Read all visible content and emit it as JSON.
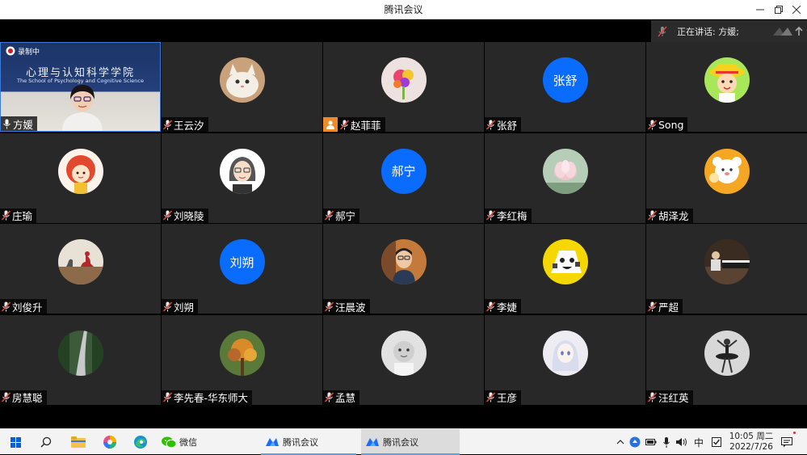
{
  "window": {
    "title": "腾讯会议",
    "speaking_prefix": "正在讲话: 方媛;"
  },
  "presenter": {
    "banner_cn": "心理与认知科学学院",
    "banner_en": "The School of Psychology and Cognitive Science",
    "recording_label": "录制中"
  },
  "participants": [
    {
      "name": "方媛",
      "avatar": "camera",
      "mic": "on"
    },
    {
      "name": "王云汐",
      "avatar": "cat-photo",
      "mic": "muted"
    },
    {
      "name": "赵菲菲",
      "avatar": "flowers-photo",
      "mic": "muted",
      "badge": "person-icon"
    },
    {
      "name": "张舒",
      "avatar": "text",
      "avatar_text": "张舒",
      "mic": "muted"
    },
    {
      "name": "Song",
      "avatar": "cartoon-boy",
      "mic": "muted"
    },
    {
      "name": "庄瑜",
      "avatar": "cartoon-girl",
      "mic": "muted"
    },
    {
      "name": "刘晓陵",
      "avatar": "cartoon-woman",
      "mic": "muted"
    },
    {
      "name": "郝宁",
      "avatar": "text",
      "avatar_text": "郝宁",
      "mic": "muted"
    },
    {
      "name": "李红梅",
      "avatar": "lotus-photo",
      "mic": "muted"
    },
    {
      "name": "胡泽龙",
      "avatar": "cartoon-bear",
      "mic": "muted"
    },
    {
      "name": "刘俊升",
      "avatar": "swan-photo",
      "mic": "muted"
    },
    {
      "name": "刘朔",
      "avatar": "text",
      "avatar_text": "刘朔",
      "mic": "muted"
    },
    {
      "name": "汪晨波",
      "avatar": "man-photo",
      "mic": "muted"
    },
    {
      "name": "李婕",
      "avatar": "cartoon-yellow",
      "mic": "muted"
    },
    {
      "name": "严超",
      "avatar": "piano-photo",
      "mic": "muted"
    },
    {
      "name": "房慧聪",
      "avatar": "road-photo",
      "mic": "muted"
    },
    {
      "name": "李先春-华东师大",
      "avatar": "tree-photo",
      "mic": "muted"
    },
    {
      "name": "孟慧",
      "avatar": "baby-photo",
      "mic": "muted"
    },
    {
      "name": "王彦",
      "avatar": "anime-photo",
      "mic": "muted"
    },
    {
      "name": "汪红英",
      "avatar": "dancer-photo",
      "mic": "muted"
    }
  ],
  "taskbar": {
    "apps": [
      {
        "label": "微信",
        "icon": "wechat-icon"
      },
      {
        "label": "腾讯会议",
        "icon": "tencent-meeting-icon"
      },
      {
        "label": "腾讯会议",
        "icon": "tencent-meeting-icon",
        "active": true
      }
    ],
    "ime": "中",
    "time": "10:05 周二",
    "date": "2022/7/26"
  },
  "colors": {
    "text_avatar_bg": "#0a6cff",
    "tile_bg": "#282828",
    "presenter_border": "#3d7bd9"
  }
}
